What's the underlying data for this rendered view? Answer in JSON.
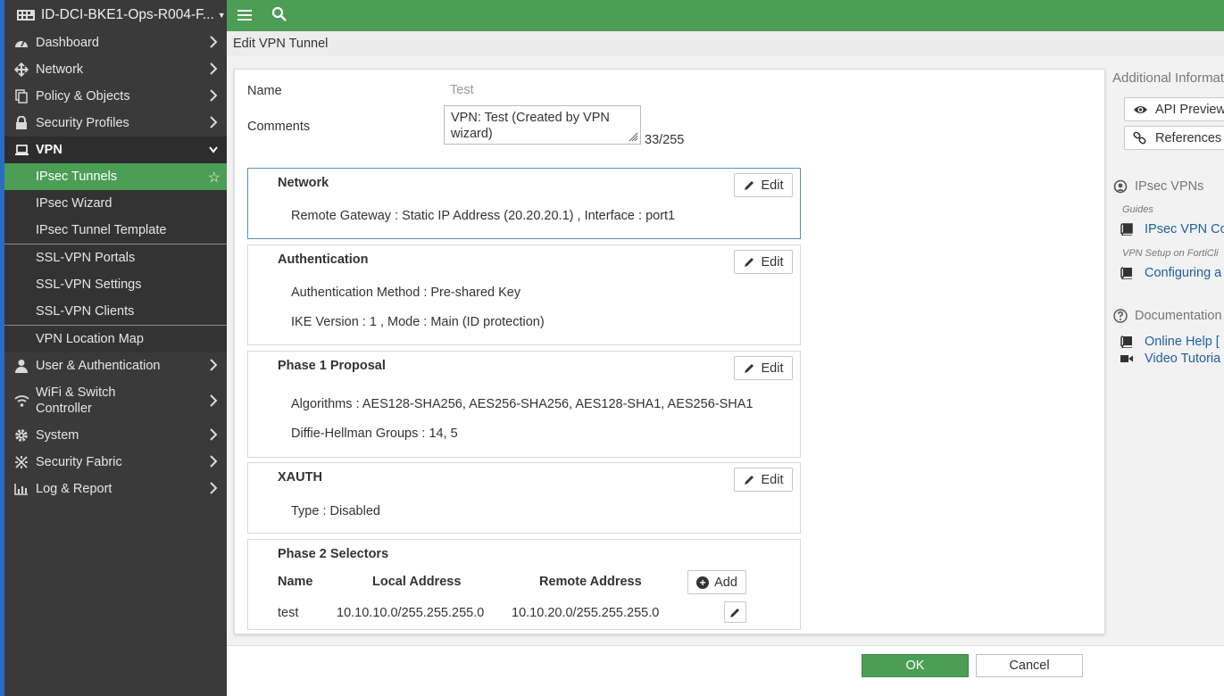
{
  "colors": {
    "brand_green": "#4c9d55",
    "sidebar_bg": "#3a3a3a",
    "link_blue": "#1f5f9e"
  },
  "sidebar": {
    "device_name": "ID-DCI-BKE1-Ops-R004-F...",
    "items": {
      "dashboard": "Dashboard",
      "network": "Network",
      "policy": "Policy & Objects",
      "security_profiles": "Security Profiles",
      "vpn": "VPN",
      "ipsec_tunnels": "IPsec Tunnels",
      "ipsec_wizard": "IPsec Wizard",
      "ipsec_template": "IPsec Tunnel Template",
      "ssl_portals": "SSL-VPN Portals",
      "ssl_settings": "SSL-VPN Settings",
      "ssl_clients": "SSL-VPN Clients",
      "vpn_map": "VPN Location Map",
      "user_auth": "User & Authentication",
      "wifi_line1": "WiFi & Switch",
      "wifi_line2": "Controller",
      "system": "System",
      "security_fabric": "Security Fabric",
      "log_report": "Log & Report"
    }
  },
  "page": {
    "title": "Edit VPN Tunnel"
  },
  "form": {
    "name_label": "Name",
    "name_value": "Test",
    "comments_label": "Comments",
    "comments_line1": "VPN: Test (Created by VPN",
    "comments_line2": "wizard)",
    "comments_count": "33/255",
    "edit_label": "Edit",
    "network": {
      "title": "Network",
      "line1": "Remote Gateway : Static IP Address (20.20.20.1) , Interface : port1"
    },
    "authentication": {
      "title": "Authentication",
      "line1": "Authentication Method : Pre-shared Key",
      "line2": "IKE Version : 1 , Mode : Main (ID protection)"
    },
    "phase1": {
      "title": "Phase 1 Proposal",
      "line1": "Algorithms : AES128-SHA256, AES256-SHA256, AES128-SHA1, AES256-SHA1",
      "line2": "Diffie-Hellman Groups : 14, 5"
    },
    "xauth": {
      "title": "XAUTH",
      "line1": "Type : Disabled"
    },
    "phase2": {
      "title": "Phase 2 Selectors",
      "add_label": "Add",
      "columns": [
        "Name",
        "Local Address",
        "Remote Address"
      ],
      "rows": [
        {
          "name": "test",
          "local": "10.10.10.0/255.255.255.0",
          "remote": "10.10.20.0/255.255.255.0"
        }
      ]
    }
  },
  "info": {
    "heading": "Additional Informat",
    "api_preview": "API Preview",
    "references": "References",
    "ipsec_vpns": "IPsec VPNs",
    "guides_label": "Guides",
    "guide_link": "IPsec VPN Co",
    "setup_label": "VPN Setup on FortiCli",
    "setup_link": "Configuring a",
    "documentation": "Documentation",
    "online_help": "Online Help [",
    "video_tutorials": "Video Tutoria"
  },
  "footer": {
    "ok": "OK",
    "cancel": "Cancel"
  }
}
